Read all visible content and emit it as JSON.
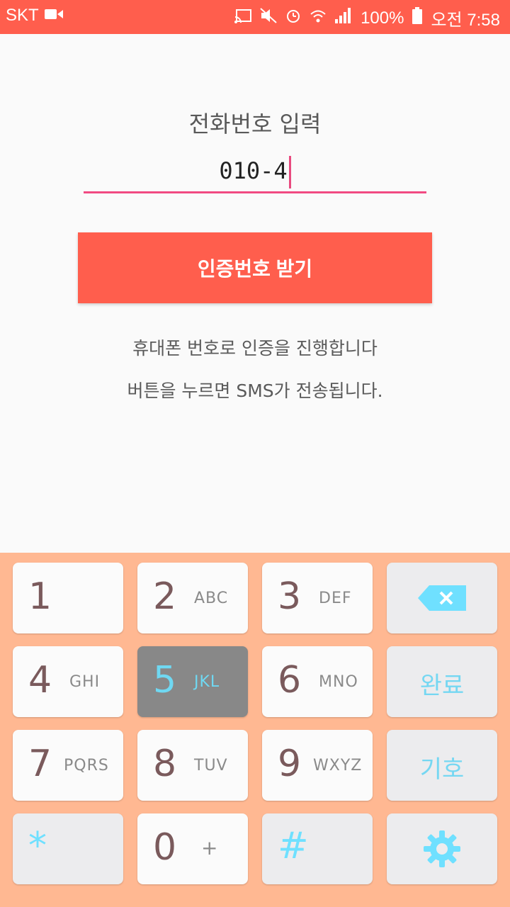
{
  "status_bar": {
    "carrier": "SKT",
    "battery": "100%",
    "time": "오전 7:58"
  },
  "main": {
    "title": "전화번호 입력",
    "phone_value": "010-4",
    "button_label": "인증번호 받기",
    "info_line_1": "휴대폰 번호로 인증을 진행합니다",
    "info_line_2": "버튼을 누르면 SMS가 전송됩니다."
  },
  "keyboard": {
    "keys": [
      {
        "digit": "1",
        "letters": ""
      },
      {
        "digit": "2",
        "letters": "ABC"
      },
      {
        "digit": "3",
        "letters": "DEF"
      },
      {
        "digit": "4",
        "letters": "GHI"
      },
      {
        "digit": "5",
        "letters": "JKL"
      },
      {
        "digit": "6",
        "letters": "MNO"
      },
      {
        "digit": "7",
        "letters": "PQRS"
      },
      {
        "digit": "8",
        "letters": "TUV"
      },
      {
        "digit": "9",
        "letters": "WXYZ"
      },
      {
        "digit": "0",
        "letters": "+"
      }
    ],
    "done_label": "완료",
    "symbols_label": "기호",
    "asterisk": "*",
    "hash": "#"
  },
  "colors": {
    "accent": "#ff5e4d",
    "input_underline": "#f14a82",
    "keyboard_bg": "#ffb892",
    "key_icon": "#6fe0ff"
  },
  "icons": [
    "video-icon",
    "cast-icon",
    "mute-icon",
    "alarm-icon",
    "wifi-icon",
    "signal-icon",
    "battery-icon",
    "backspace-icon",
    "gear-icon"
  ]
}
